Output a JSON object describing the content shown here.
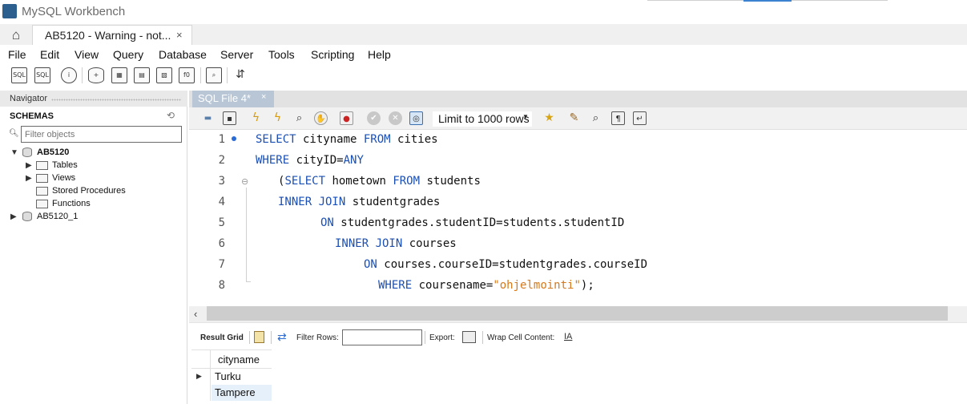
{
  "window": {
    "app_title": "MySQL Workbench"
  },
  "tabs": {
    "connection_tab_label": "AB5120 - Warning - not...",
    "close_glyph": "×"
  },
  "menu": [
    "File",
    "Edit",
    "View",
    "Query",
    "Database",
    "Server",
    "Tools",
    "Scripting",
    "Help"
  ],
  "navigator": {
    "title": "Navigator",
    "schemas_title": "SCHEMAS",
    "filter_placeholder": "Filter objects",
    "tree": {
      "db1": "AB5120",
      "tables": "Tables",
      "views": "Views",
      "procedures": "Stored Procedures",
      "functions": "Functions",
      "db2": "AB5120_1"
    }
  },
  "sql_editor": {
    "tab_label": "SQL File 4*",
    "tab_close": "×",
    "limit_select": "Limit to 1000 rows",
    "line_numbers": [
      "1",
      "2",
      "3",
      "4",
      "5",
      "6",
      "7",
      "8"
    ],
    "lines": [
      {
        "kw1": "SELECT",
        "t1": " cityname ",
        "kw2": "FROM",
        "t2": " cities"
      },
      {
        "kw1": "WHERE",
        "t1": " cityID=",
        "kw2": "ANY"
      },
      {
        "t0": "(",
        "kw1": "SELECT",
        "t1": " hometown ",
        "kw2": "FROM",
        "t2": " students"
      },
      {
        "kw1": "INNER JOIN",
        "t1": " studentgrades"
      },
      {
        "kw1": "ON",
        "t1": " studentgrades.studentID=students.studentID"
      },
      {
        "kw1": "INNER JOIN",
        "t1": " courses"
      },
      {
        "kw1": "ON",
        "t1": " courses.courseID=studentgrades.courseID"
      },
      {
        "kw1": "WHERE",
        "t1": " coursename=",
        "str": "\"ohjelmointi\"",
        "t2": ");"
      }
    ]
  },
  "results": {
    "result_grid_label": "Result Grid",
    "filter_rows_label": "Filter Rows:",
    "export_label": "Export:",
    "wrap_label": "Wrap Cell Content:",
    "column_header": "cityname",
    "rows": [
      "Turku",
      "Tampere"
    ],
    "row_pointer": "▶"
  },
  "colors": {
    "keyword": "#1b4fb3",
    "string": "#d7791b",
    "selection_row": "#e6f0fb"
  },
  "icons": [
    "home-icon",
    "new-sql-tab-icon",
    "open-sql-script-icon",
    "schema-inspector-icon",
    "create-schema-icon",
    "create-table-icon",
    "create-view-icon",
    "create-procedure-icon",
    "create-function-icon",
    "search-table-data-icon",
    "reconnect-icon"
  ]
}
